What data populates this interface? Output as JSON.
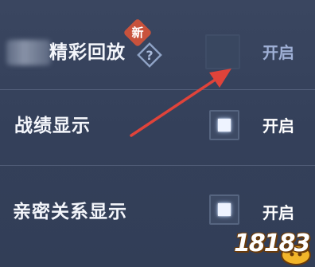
{
  "settings": [
    {
      "label": "精彩回放",
      "badge": "新",
      "toggle_text": "开启",
      "enabled": false
    },
    {
      "label": "战绩显示",
      "toggle_text": "开启",
      "enabled": true
    },
    {
      "label": "亲密关系显示",
      "toggle_text": "开启",
      "enabled": true
    }
  ],
  "help_icon": "question-diamond-icon",
  "annotation": {
    "type": "red-arrow",
    "color": "#e0433a"
  },
  "watermark": {
    "text": "18183",
    "icon": "game-controller-icon"
  },
  "colors": {
    "background": "#37435c",
    "text_active": "#f4f6fb",
    "text_inactive": "#9fb0d6",
    "badge": "#c8523c"
  }
}
